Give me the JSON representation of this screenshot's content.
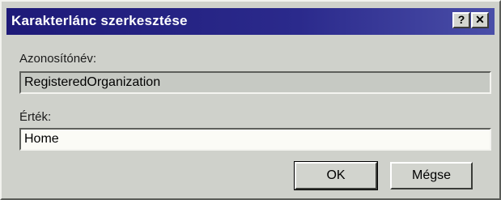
{
  "window": {
    "title": "Karakterlánc szerkesztése",
    "help_button": "?",
    "close_button": "✕"
  },
  "form": {
    "name_label": "Azonosítónév:",
    "name_value": "RegisteredOrganization",
    "value_label": "Érték:",
    "value_value": "Home"
  },
  "buttons": {
    "ok": "OK",
    "cancel": "Mégse"
  }
}
